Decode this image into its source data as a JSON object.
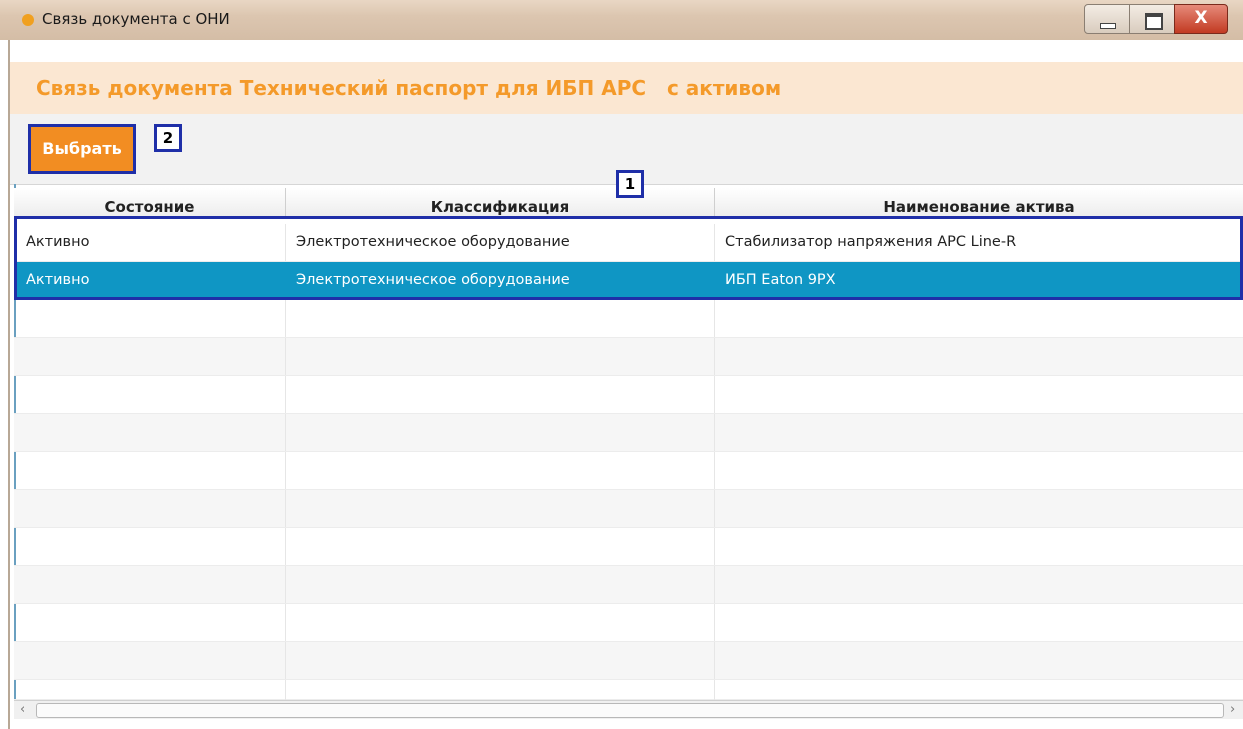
{
  "window": {
    "title": "Связь документа с ОНИ",
    "close_label": "X"
  },
  "header": {
    "heading": "Связь документа Технический паспорт для ИБП APC   с активом"
  },
  "toolbar": {
    "select_label": "Выбрать"
  },
  "callouts": {
    "one": "1",
    "two": "2"
  },
  "table": {
    "columns": [
      "Состояние",
      "Классификация",
      "Наименование актива"
    ],
    "rows": [
      {
        "status": "Активно",
        "classification": "Электротехническое оборудование",
        "name": "Стабилизатор напряжения APC Line-R"
      },
      {
        "status": "Активно",
        "classification": "Электротехническое оборудование",
        "name": "ИБП Eaton 9PX"
      }
    ]
  },
  "scrollbar": {
    "left_arrow": "‹",
    "right_arrow": "›"
  },
  "colors": {
    "accent": "#f28d22",
    "selection": "#0f96c4",
    "callout_border": "#1f2fa8"
  }
}
